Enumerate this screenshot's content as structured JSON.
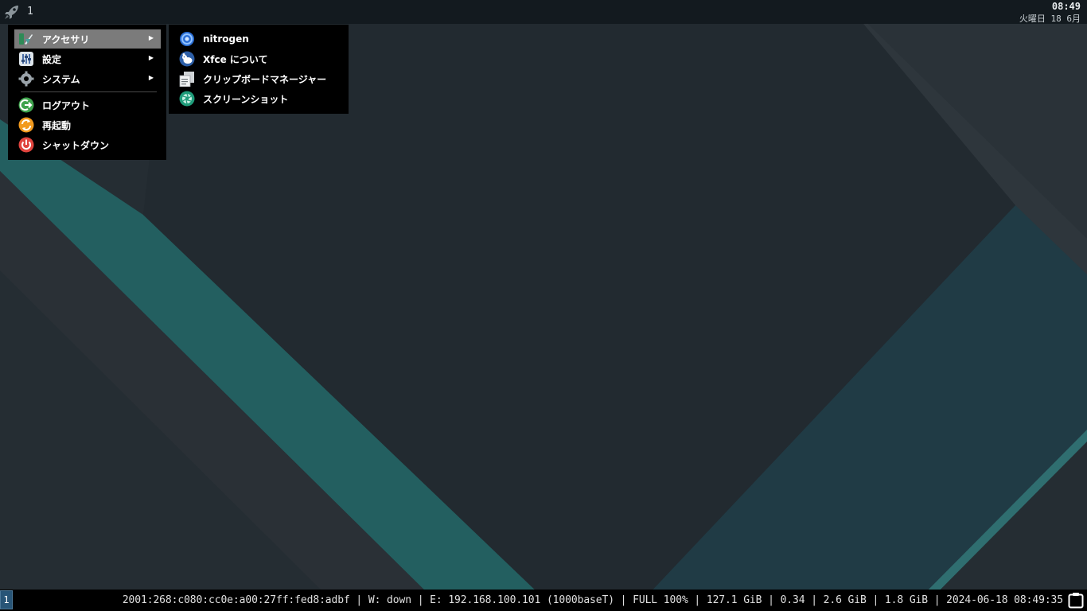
{
  "top_panel": {
    "workspace_label": "1",
    "clock_time": "08:49",
    "clock_date": "火曜日 18 6月"
  },
  "main_menu": {
    "items": [
      {
        "label": "アクセサリ",
        "icon": "accessories-icon",
        "submenu": true
      },
      {
        "label": "設定",
        "icon": "settings-icon",
        "submenu": true
      },
      {
        "label": "システム",
        "icon": "system-gear-icon",
        "submenu": true
      },
      {
        "label": "ログアウト",
        "icon": "logout-icon",
        "submenu": false
      },
      {
        "label": "再起動",
        "icon": "restart-icon",
        "submenu": false
      },
      {
        "label": "シャットダウン",
        "icon": "power-icon",
        "submenu": false
      }
    ],
    "arrow_glyph": "▶"
  },
  "sub_menu": {
    "items": [
      {
        "label": "nitrogen",
        "icon": "nitrogen-icon"
      },
      {
        "label": "Xfce について",
        "icon": "xfce-mouse-icon"
      },
      {
        "label": "クリップボードマネージャー",
        "icon": "clipboard-icon"
      },
      {
        "label": "スクリーンショット",
        "icon": "camera-shutter-icon"
      }
    ]
  },
  "bottom_bar": {
    "workspace_button": "1",
    "status_line": "2001:268:c080:cc0e:a00:27ff:fed8:adbf | W: down | E: 192.168.100.101 (1000baseT) | FULL 100% | 127.1 GiB | 0.34 | 2.6 GiB | 1.8 GiB | 2024-06-18 08:49:35"
  },
  "colors": {
    "menu_bg": "#000000",
    "menu_active": "#7b7b7b",
    "panel_bg": "#131a1f",
    "wallpaper_base": "#252d33",
    "wallpaper_teal": "#235f60",
    "workspace_focus": "#285577"
  }
}
